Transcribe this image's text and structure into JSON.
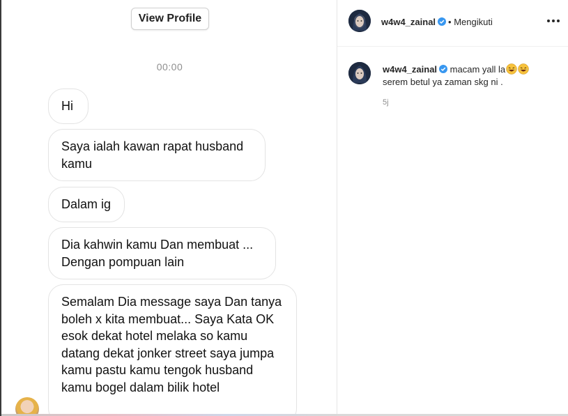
{
  "chat": {
    "view_profile_label": "View Profile",
    "timestamp": "00:00",
    "messages": [
      "Hi",
      "Saya ialah kawan rapat husband kamu",
      "Dalam ig",
      "Dia kahwin kamu Dan membuat ... Dengan pompuan lain",
      "Semalam Dia message saya Dan tanya boleh x kita membuat... Saya Kata OK esok dekat hotel melaka so kamu datang dekat jonker street saya jumpa kamu pastu kamu tengok husband kamu bogel dalam bilik hotel"
    ]
  },
  "post": {
    "username": "w4w4_zainal",
    "follow_status": "• Mengikuti",
    "caption_text": "macam yall la",
    "caption_line2": "serem betul ya zaman skg ni .",
    "caption_emojis": [
      "rolling-on-floor-laughing-emoji",
      "rolling-on-floor-laughing-emoji"
    ],
    "age": "5j",
    "verified_icon": "verified-badge-icon",
    "more_icon": "more-options-icon"
  },
  "colors": {
    "verified_blue": "#3897f0",
    "muted_text": "#8e8e8e",
    "bubble_border": "#e3e3e3"
  }
}
